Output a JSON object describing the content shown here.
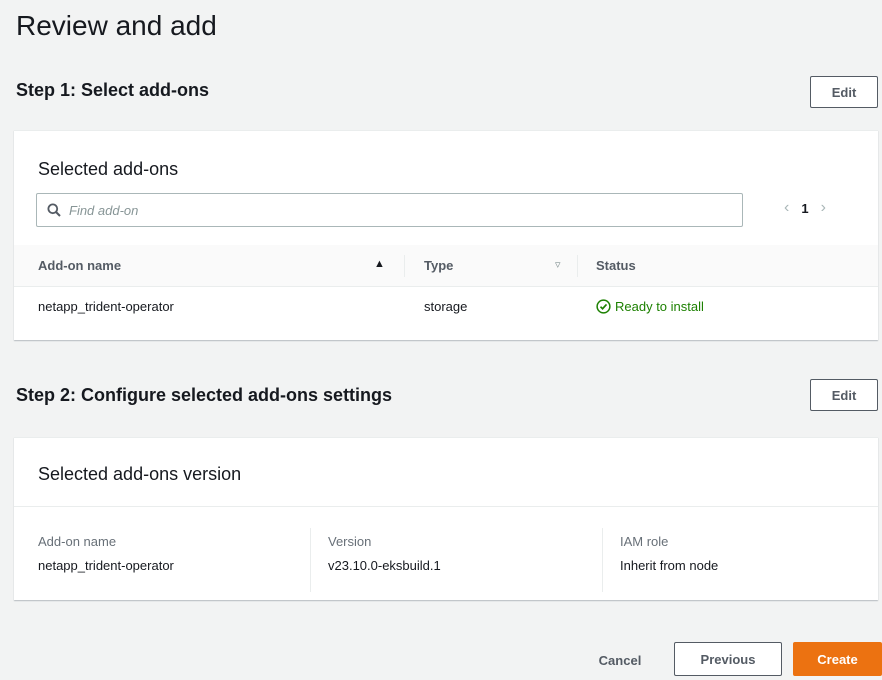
{
  "page": {
    "title": "Review and add"
  },
  "step1": {
    "header": "Step 1: Select add-ons",
    "edit_label": "Edit",
    "panel_title": "Selected add-ons",
    "search": {
      "placeholder": "Find add-on",
      "value": ""
    },
    "pagination": {
      "prev_icon": "chevron-left-icon",
      "current_page": "1",
      "next_icon": "chevron-right-icon"
    },
    "columns": [
      "Add-on name",
      "Type",
      "Status"
    ],
    "rows": [
      {
        "name": "netapp_trident-operator",
        "type": "storage",
        "status": "Ready to install"
      }
    ]
  },
  "step2": {
    "header": "Step 2: Configure selected add-ons settings",
    "edit_label": "Edit",
    "panel_title": "Selected add-ons version",
    "fields": [
      {
        "label": "Add-on name",
        "value": "netapp_trident-operator"
      },
      {
        "label": "Version",
        "value": "v23.10.0-eksbuild.1"
      },
      {
        "label": "IAM role",
        "value": "Inherit from node"
      }
    ]
  },
  "footer": {
    "cancel_label": "Cancel",
    "previous_label": "Previous",
    "create_label": "Create"
  },
  "colors": {
    "primary": "#ec7211",
    "success": "#1d8102",
    "text": "#16191f",
    "muted": "#687078"
  }
}
